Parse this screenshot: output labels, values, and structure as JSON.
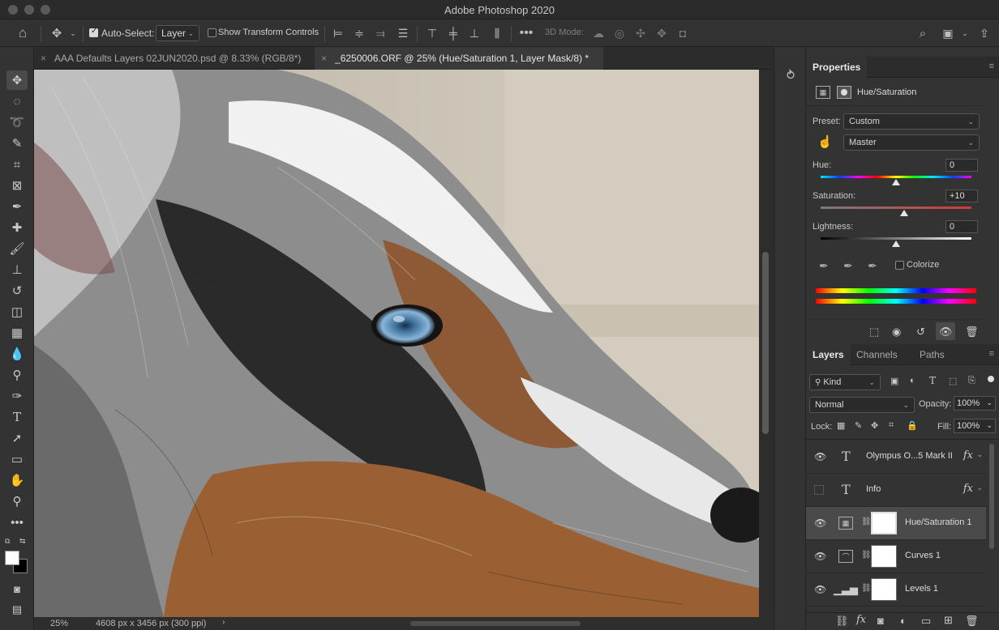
{
  "window": {
    "title": "Adobe Photoshop 2020"
  },
  "options_bar": {
    "auto_select_label": "Auto-Select:",
    "auto_select_checked": true,
    "auto_select_target": "Layer",
    "show_transform_label": "Show Transform Controls",
    "show_transform_checked": false,
    "mode_3d_label": "3D Mode:"
  },
  "tabs": [
    {
      "label": "AAA Defaults Layers 02JUN2020.psd @ 8.33% (RGB/8*)",
      "active": false
    },
    {
      "label": "_6250006.ORF @ 25% (Hue/Saturation 1, Layer Mask/8) *",
      "active": true
    }
  ],
  "status": {
    "zoom": "25%",
    "doc_info": "4608 px x 3456 px (300 ppi)"
  },
  "properties": {
    "tab_label": "Properties",
    "adjustment_name": "Hue/Saturation",
    "preset_label": "Preset:",
    "preset_value": "Custom",
    "channel_value": "Master",
    "hue_label": "Hue:",
    "hue_value": "0",
    "saturation_label": "Saturation:",
    "saturation_value": "+10",
    "lightness_label": "Lightness:",
    "lightness_value": "0",
    "colorize_label": "Colorize",
    "colorize_checked": false
  },
  "layers_panel": {
    "tabs": [
      "Layers",
      "Channels",
      "Paths"
    ],
    "filter_kind": "Kind",
    "blend_mode": "Normal",
    "opacity_label": "Opacity:",
    "opacity_value": "100%",
    "lock_label": "Lock:",
    "fill_label": "Fill:",
    "fill_value": "100%",
    "layers": [
      {
        "name": "Olympus O...5 Mark II",
        "type": "text",
        "visible": true,
        "fx": "fx",
        "selected": false
      },
      {
        "name": "Info",
        "type": "text",
        "visible": false,
        "fx": "fx",
        "selected": false
      },
      {
        "name": "Hue/Saturation 1",
        "type": "adjustment",
        "visible": true,
        "fx": "",
        "selected": true
      },
      {
        "name": "Curves 1",
        "type": "adjustment",
        "visible": true,
        "fx": "",
        "selected": false
      },
      {
        "name": "Levels 1",
        "type": "adjustment",
        "visible": true,
        "fx": "",
        "selected": false
      }
    ]
  },
  "colors": {
    "background": "#3c3c3c",
    "panel": "#333333",
    "selected_layer": "#4a4a4a"
  }
}
